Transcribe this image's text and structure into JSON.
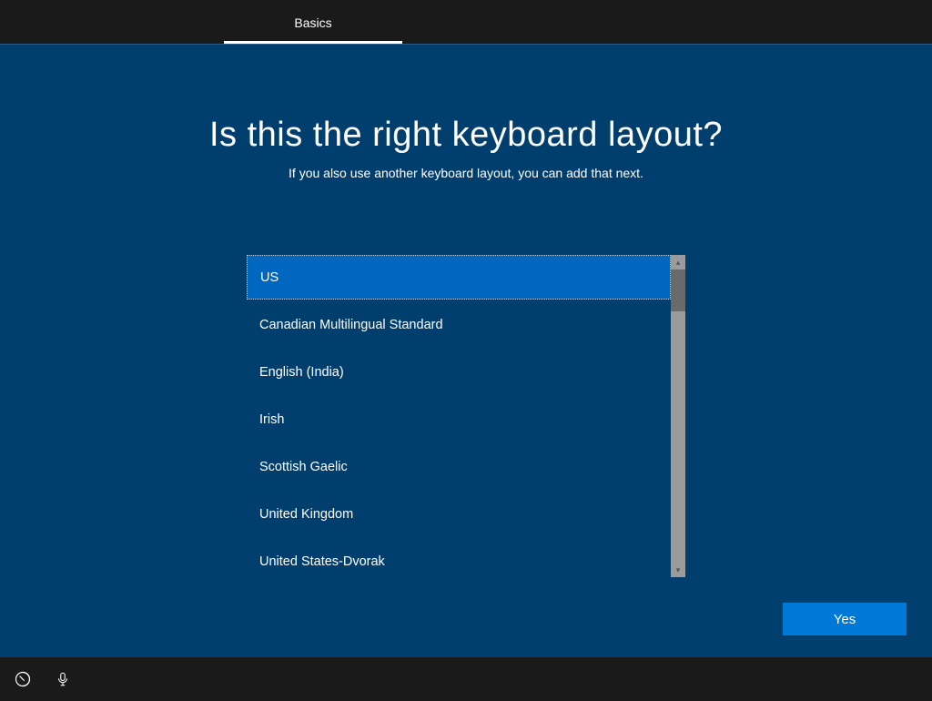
{
  "tab": {
    "label": "Basics"
  },
  "main": {
    "heading": "Is this the right keyboard layout?",
    "subheading": "If you also use another keyboard layout, you can add that next."
  },
  "keyboard_layouts": {
    "selected_index": 0,
    "items": [
      "US",
      "Canadian Multilingual Standard",
      "English (India)",
      "Irish",
      "Scottish Gaelic",
      "United Kingdom",
      "United States-Dvorak"
    ]
  },
  "actions": {
    "yes_label": "Yes"
  },
  "colors": {
    "background": "#003e6e",
    "accent": "#0078d7",
    "selected": "#0067c0",
    "top_bar": "#1a1a1a"
  }
}
